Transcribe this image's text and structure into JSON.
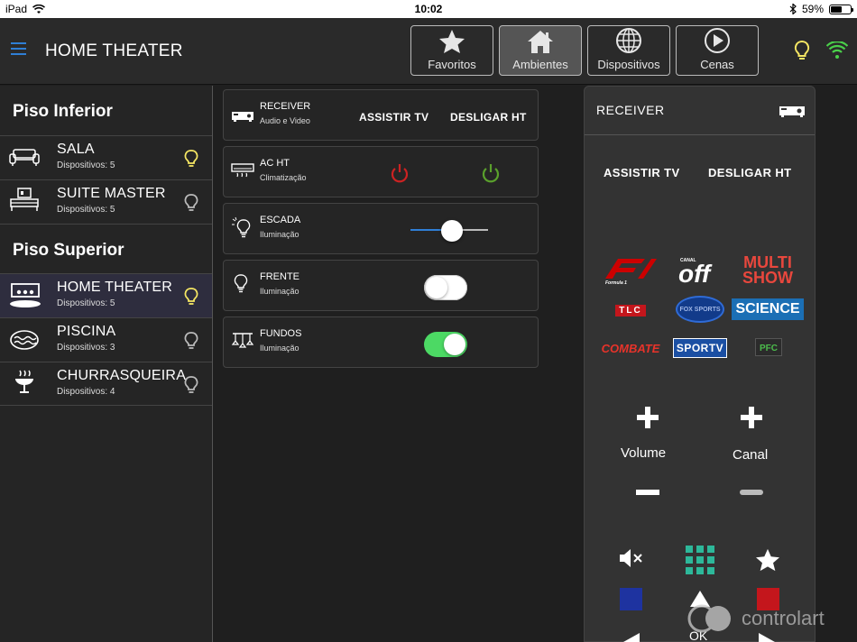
{
  "statusbar": {
    "device": "iPad",
    "time": "10:02",
    "battery": "59%",
    "battery_level": 0.59
  },
  "header": {
    "title": "HOME THEATER"
  },
  "nav": [
    {
      "label": "Favoritos",
      "icon": "star-icon",
      "active": false
    },
    {
      "label": "Ambientes",
      "icon": "home-icon",
      "active": true
    },
    {
      "label": "Dispositivos",
      "icon": "globe-icon",
      "active": false
    },
    {
      "label": "Cenas",
      "icon": "play-icon",
      "active": false
    }
  ],
  "sidebar": {
    "floors": [
      {
        "name": "Piso Inferior",
        "rooms": [
          {
            "name": "SALA",
            "devices": "Dispositivos: 5",
            "light_on": true
          },
          {
            "name": "SUITE MASTER",
            "devices": "Dispositivos: 5",
            "light_on": false
          }
        ]
      },
      {
        "name": "Piso Superior",
        "rooms": [
          {
            "name": "HOME THEATER",
            "devices": "Dispositivos: 5",
            "light_on": true,
            "active": true
          },
          {
            "name": "PISCINA",
            "devices": "Dispositivos: 3",
            "light_on": false
          },
          {
            "name": "CHURRASQUEIRA",
            "devices": "Dispositivos: 4",
            "light_on": false
          }
        ]
      }
    ]
  },
  "devices": [
    {
      "name": "RECEIVER",
      "type": "Audio e Video",
      "action1": "ASSISTIR TV",
      "action2": "DESLIGAR HT"
    },
    {
      "name": "AC HT",
      "type": "Climatização"
    },
    {
      "name": "ESCADA",
      "type": "Iluminação",
      "dimmer_level": 0.53
    },
    {
      "name": "FRENTE",
      "type": "Iluminação",
      "on": false
    },
    {
      "name": "FUNDOS",
      "type": "Iluminação",
      "on": true
    }
  ],
  "remote": {
    "title": "RECEIVER",
    "action1": "ASSISTIR TV",
    "action2": "DESLIGAR HT",
    "channels": [
      "F1",
      "off",
      "MULTI SHOW",
      "TLC",
      "FOX SPORTS",
      "SCIENCE",
      "COMBATE",
      "SPORTV",
      "PFC"
    ],
    "volume_label": "Volume",
    "channel_label": "Canal",
    "ok_label": "OK"
  },
  "watermark": "controlart",
  "colors": {
    "accent_blue": "#2f7fd6",
    "bulb_on": "#f5e663",
    "toggle_on": "#4cd964",
    "power_red": "#cc2222",
    "power_green": "#5aa02c",
    "wifi": "#4ad04a"
  }
}
